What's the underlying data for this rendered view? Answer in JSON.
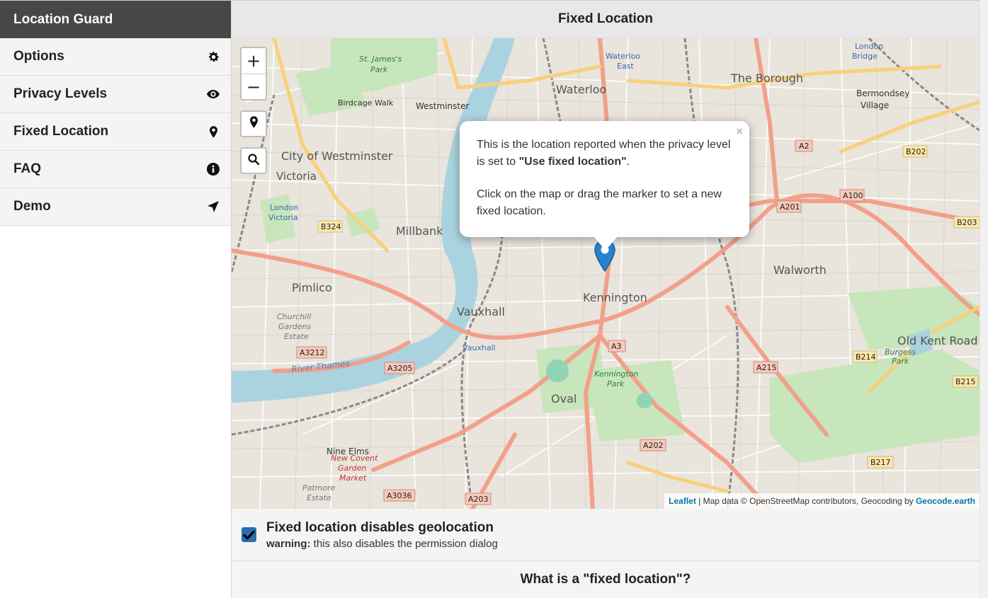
{
  "app": {
    "title": "Location Guard"
  },
  "sidebar": {
    "items": [
      {
        "label": "Options",
        "icon": "gear-icon"
      },
      {
        "label": "Privacy Levels",
        "icon": "eye-icon"
      },
      {
        "label": "Fixed Location",
        "icon": "map-pin-icon"
      },
      {
        "label": "FAQ",
        "icon": "info-icon"
      },
      {
        "label": "Demo",
        "icon": "location-arrow-icon"
      }
    ]
  },
  "header": {
    "title": "Fixed Location"
  },
  "map": {
    "controls": {
      "zoom_in": "+",
      "zoom_out": "−"
    },
    "popup": {
      "line1_prefix": "This is the location reported when the privacy level is set to ",
      "line1_bold": "\"Use fixed location\"",
      "line1_suffix": ".",
      "line2": "Click on the map or drag the marker to set a new fixed location.",
      "close": "×"
    },
    "attribution": {
      "leaflet": "Leaflet",
      "text": " | Map data © OpenStreetMap contributors, Geocoding by ",
      "geocode": "Geocode.earth"
    },
    "labels": {
      "westminster_city": "City of Westminster",
      "victoria": "Victoria",
      "millbank": "Millbank",
      "pimlico": "Pimlico",
      "vauxhall": "Vauxhall",
      "kennington": "Kennington",
      "walworth": "Walworth",
      "borough": "The Borough",
      "waterloo": "Waterloo",
      "westminster": "Westminster",
      "bermondsey": "Bermondsey",
      "village": "Village",
      "oval": "Oval",
      "nine_elms": "Nine Elms",
      "old_kent_road": "Old Kent Road",
      "st_james": "St. James's",
      "park": "Park",
      "birdcage": "Birdcage Walk",
      "waterloo_east": "Waterloo",
      "east": "East",
      "london_bridge": "London",
      "bridge": "Bridge",
      "kennington_park": "Kennington",
      "kp_park": "Park",
      "burgess": "Burgess",
      "burgess_park": "Park",
      "churchill": "Churchill",
      "gardens": "Gardens",
      "estate": "Estate",
      "new_covent": "New Covent",
      "garden": "Garden",
      "market": "Market",
      "patmore": "Patmore",
      "patmore_estate": "Estate",
      "river_thames": "River Thames",
      "a2": "A2",
      "a100": "A100",
      "a201": "A201",
      "b202": "B202",
      "b203": "B203",
      "b324": "B324",
      "a3212": "A3212",
      "a3205": "A3205",
      "a3": "A3",
      "a215": "A215",
      "b214": "B214",
      "b215": "B215",
      "a202": "A202",
      "b217": "B217",
      "a3036": "A3036",
      "a203": "A203",
      "london_victoria": "London",
      "victoria_st": "Victoria",
      "vauxhall_st": "Vauxhall"
    }
  },
  "option": {
    "title": "Fixed location disables geolocation",
    "warning_label": "warning:",
    "warning_text": " this also disables the permission dialog",
    "checked": true
  },
  "faq": {
    "title": "What is a \"fixed location\"?"
  }
}
